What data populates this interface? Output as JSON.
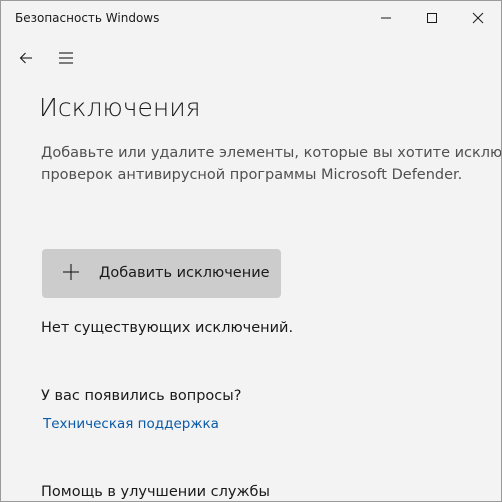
{
  "window": {
    "title": "Безопасность Windows"
  },
  "page": {
    "title": "Исключения",
    "description_line1": "Добавьте или удалите элементы, которые вы хотите исключить из",
    "description_line2": "проверок антивирусной программы Microsoft Defender."
  },
  "actions": {
    "add_exclusion_label": "Добавить исключение"
  },
  "status": {
    "no_exclusions": "Нет существующих исключений."
  },
  "help": {
    "questions_heading": "У вас появились вопросы?",
    "support_link": "Техническая поддержка"
  },
  "improve": {
    "heading": "Помощь в улучшении службы"
  },
  "icons": {
    "back": "back-arrow-icon",
    "menu": "hamburger-menu-icon",
    "add": "plus-icon",
    "minimize": "minimize-icon",
    "maximize": "maximize-icon",
    "close": "close-icon"
  },
  "colors": {
    "background": "#f3f3f3",
    "button_background": "#cccccc",
    "link": "#0a5aa8",
    "text": "#1a1a1a",
    "secondary_text": "#505050"
  }
}
